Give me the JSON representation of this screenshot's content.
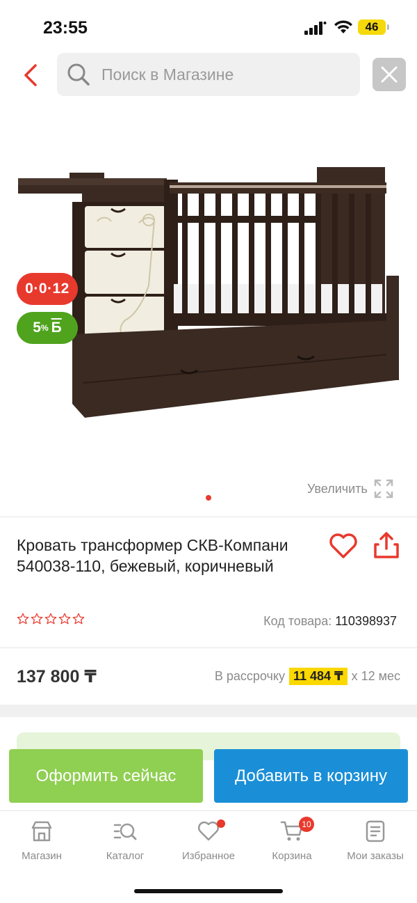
{
  "status": {
    "time": "23:55",
    "battery": "46"
  },
  "search": {
    "placeholder": "Поиск в Магазине"
  },
  "badges": {
    "installment": "0·0·12",
    "bonus_percent": "5",
    "bonus_unit": "%",
    "bonus_letter": "Б"
  },
  "gallery": {
    "zoom_label": "Увеличить",
    "current_index": 1,
    "total": 1
  },
  "product": {
    "title": "Кровать трансформер СКВ-Компани 540038-110, бежевый, коричневый",
    "rating": 0,
    "rating_max": 5,
    "sku_label": "Код товара:",
    "sku_value": "110398937",
    "price": "137 800 ₸",
    "installment_prefix": "В рассрочку",
    "installment_amount": "11 484 ₸",
    "installment_suffix": "х 12 мес"
  },
  "actions": {
    "checkout": "Оформить сейчас",
    "add_to_cart": "Добавить в корзину"
  },
  "tabbar": {
    "items": [
      {
        "label": "Магазин",
        "icon": "shop-icon"
      },
      {
        "label": "Каталог",
        "icon": "catalog-search-icon"
      },
      {
        "label": "Избранное",
        "icon": "heart-icon"
      },
      {
        "label": "Корзина",
        "icon": "cart-icon",
        "badge": "10"
      },
      {
        "label": "Мои заказы",
        "icon": "orders-icon"
      }
    ]
  },
  "colors": {
    "accent_red": "#e8392d",
    "green_button": "#8fcf52",
    "blue_button": "#1a8fd7",
    "installment_yellow": "#fbd800",
    "bonus_green": "#4fa31d"
  }
}
